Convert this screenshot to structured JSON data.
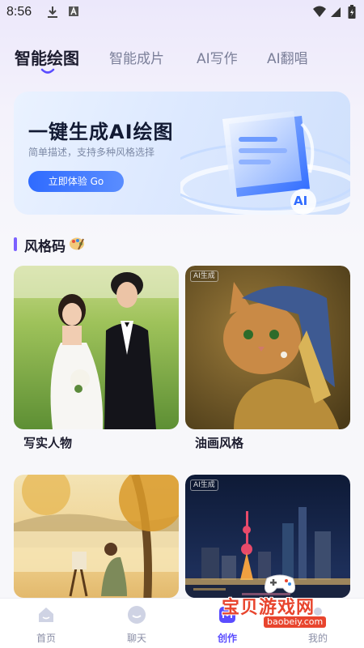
{
  "status_bar": {
    "time": "8:56"
  },
  "tabs": [
    {
      "label": "智能绘图",
      "active": true
    },
    {
      "label": "智能成片",
      "active": false
    },
    {
      "label": "AI写作",
      "active": false
    },
    {
      "label": "AI翻唱",
      "active": false
    }
  ],
  "banner": {
    "title": "一键生成AI绘图",
    "subtitle": "简单描述，支持多种风格选择",
    "button_label": "立即体验 Go",
    "badge": "AI"
  },
  "section": {
    "title": "风格码"
  },
  "cards": [
    {
      "label": "写实人物",
      "tag": ""
    },
    {
      "label": "油画风格",
      "tag": "AI生成"
    },
    {
      "label": "",
      "tag": ""
    },
    {
      "label": "",
      "tag": "AI生成"
    }
  ],
  "bottom_nav": [
    {
      "label": "首页",
      "icon": "home-icon",
      "active": false
    },
    {
      "label": "聊天",
      "icon": "chat-icon",
      "active": false
    },
    {
      "label": "创作",
      "icon": "create-icon",
      "active": true
    },
    {
      "label": "我的",
      "icon": "profile-icon",
      "active": false
    }
  ],
  "watermark": {
    "text": "宝贝游戏网",
    "url": "baobeiy.com"
  },
  "colors": {
    "accent": "#5a4cff",
    "banner_button": "#2f6bff",
    "section_bar": "#7b61ff"
  }
}
